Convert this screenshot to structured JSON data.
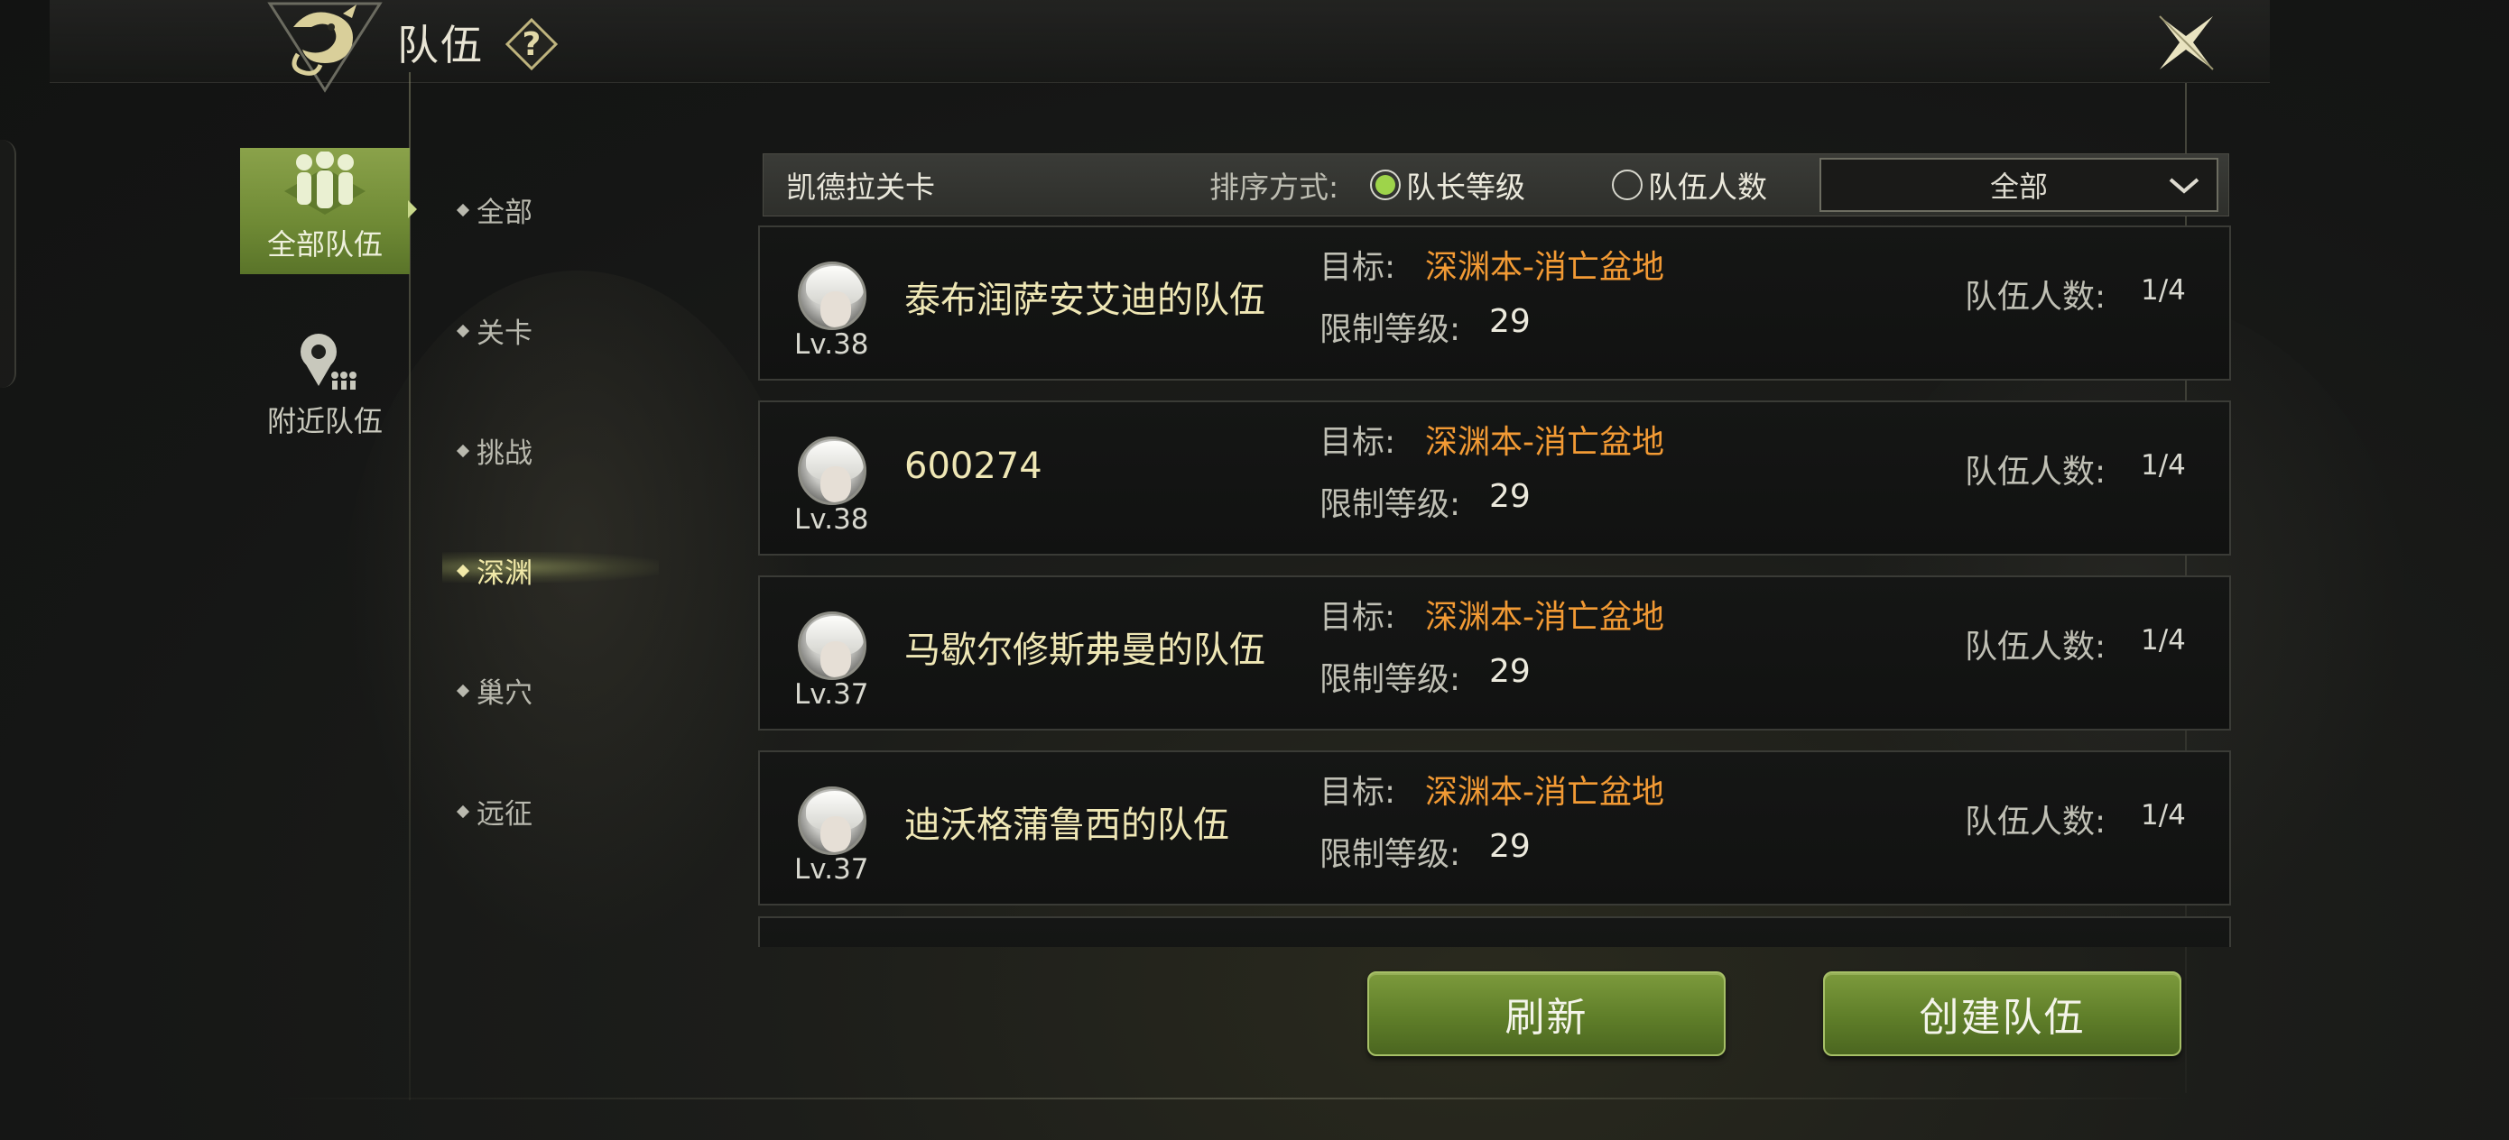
{
  "header": {
    "title": "队伍",
    "help_symbol": "?"
  },
  "categories": [
    {
      "label": "全部队伍",
      "active": true
    },
    {
      "label": "附近队伍",
      "active": false
    }
  ],
  "sub_categories": [
    {
      "label": "全部",
      "active": false
    },
    {
      "label": "关卡",
      "active": false
    },
    {
      "label": "挑战",
      "active": false
    },
    {
      "label": "深渊",
      "active": true
    },
    {
      "label": "巢穴",
      "active": false
    },
    {
      "label": "远征",
      "active": false
    }
  ],
  "filter": {
    "title": "凯德拉关卡",
    "sort_label": "排序方式:",
    "sort_options": [
      {
        "label": "队长等级",
        "selected": true
      },
      {
        "label": "队伍人数",
        "selected": false
      }
    ],
    "dropdown_value": "全部"
  },
  "row_labels": {
    "goal": "目标:",
    "level_limit": "限制等级:",
    "member_count": "队伍人数:"
  },
  "teams": [
    {
      "level": "Lv.38",
      "name": "泰布润萨安艾迪的队伍",
      "goal": "深渊本-消亡盆地",
      "level_limit": "29",
      "members": "1/4"
    },
    {
      "level": "Lv.38",
      "name": "600274",
      "goal": "深渊本-消亡盆地",
      "level_limit": "29",
      "members": "1/4"
    },
    {
      "level": "Lv.37",
      "name": "马歇尔修斯弗曼的队伍",
      "goal": "深渊本-消亡盆地",
      "level_limit": "29",
      "members": "1/4"
    },
    {
      "level": "Lv.37",
      "name": "迪沃格蒲鲁西的队伍",
      "goal": "深渊本-消亡盆地",
      "level_limit": "29",
      "members": "1/4"
    }
  ],
  "buttons": {
    "refresh": "刷新",
    "create": "创建队伍"
  },
  "colors": {
    "accent_green": "#7c9a3c",
    "goal_orange": "#f29a34",
    "name_gold": "#efe7b5",
    "radio_selected": "#9ed44a"
  }
}
